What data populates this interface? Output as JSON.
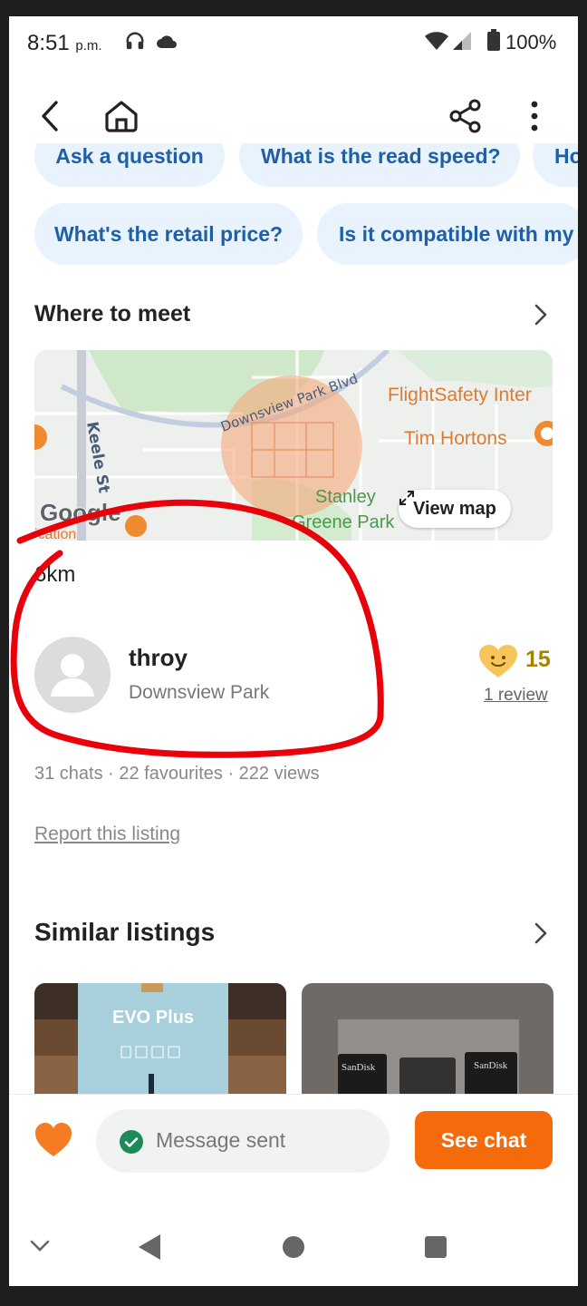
{
  "status_bar": {
    "time": "8:51",
    "time_suffix": "p.m.",
    "battery": "100%"
  },
  "chips": {
    "row1": [
      "Ask a question",
      "What is the read speed?",
      "Ho"
    ],
    "row2": [
      "What's the retail price?",
      "Is it compatible with my"
    ]
  },
  "where_to_meet": {
    "title": "Where to meet",
    "map_labels": {
      "road1": "Downsview Park Blvd",
      "road2": "Keele St",
      "poi1": "FlightSafety Inter",
      "poi2": "Tim Hortons",
      "park": "Stanley",
      "park2": "Greene Park",
      "google": "Google",
      "edge": "ication"
    },
    "view_map": "View map",
    "distance": "6km"
  },
  "seller": {
    "name": "throy",
    "location": "Downsview Park",
    "rating": "15",
    "reviews": "1 review"
  },
  "stats": "31 chats · 22 favourites · 222 views",
  "report": "Report this listing",
  "similar": {
    "title": "Similar listings",
    "card1_text": "EVO Plus",
    "card2_text": "SanDisk"
  },
  "action_bar": {
    "message_status": "Message sent",
    "see_chat": "See chat"
  },
  "colors": {
    "accent": "#f56a0a",
    "chip_bg": "#e9f3fd",
    "chip_text": "#1f5fa8",
    "rating": "#a98100",
    "annotation": "#e8000b"
  }
}
